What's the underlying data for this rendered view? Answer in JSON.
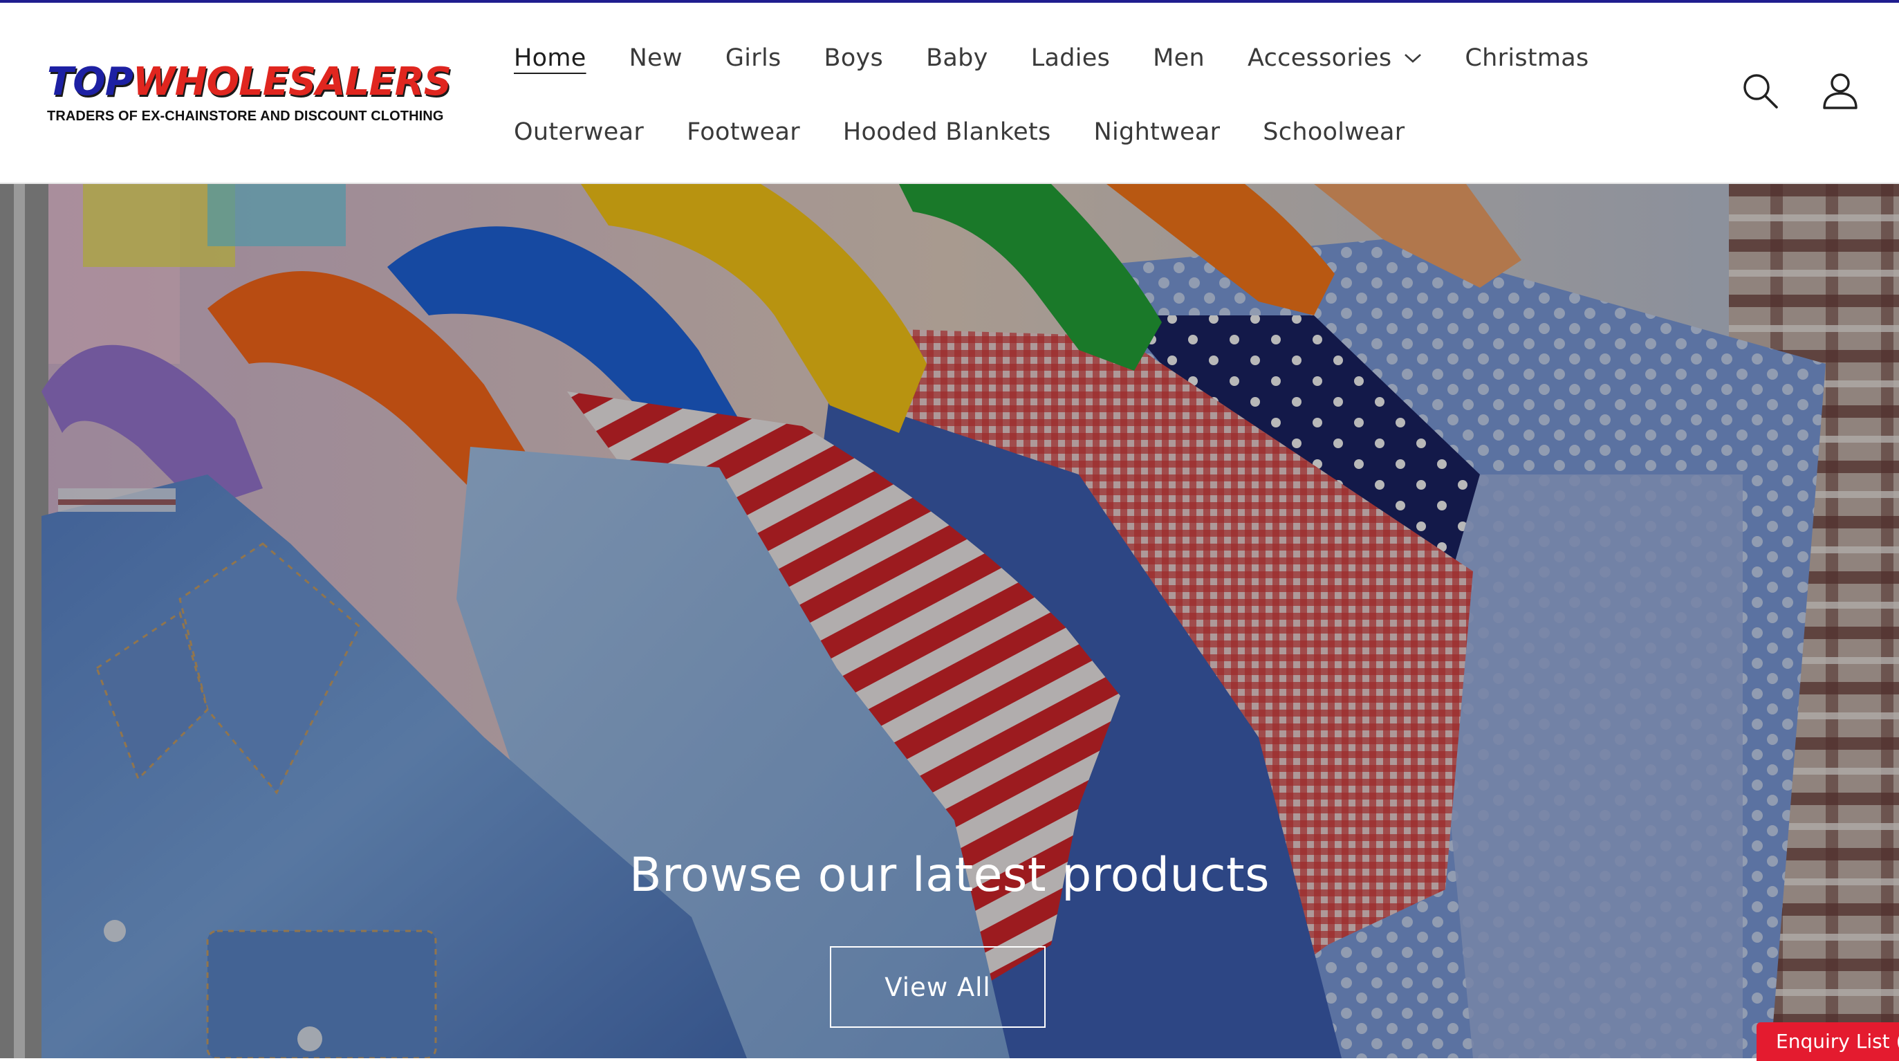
{
  "brand": {
    "name_part1": "TOP",
    "name_part2": "WHOLESALERS",
    "tagline": "TRADERS OF EX-CHAINSTORE AND DISCOUNT CLOTHING",
    "colors": {
      "primary": "#1d20a3",
      "accent": "#e0261f"
    }
  },
  "nav": {
    "row1": [
      {
        "label": "Home",
        "active": true
      },
      {
        "label": "New"
      },
      {
        "label": "Girls"
      },
      {
        "label": "Boys"
      },
      {
        "label": "Baby"
      },
      {
        "label": "Ladies"
      },
      {
        "label": "Men"
      },
      {
        "label": "Accessories",
        "dropdown": true,
        "icon": "chevron-down-icon"
      },
      {
        "label": "Christmas"
      }
    ],
    "row2": [
      {
        "label": "Outerwear"
      },
      {
        "label": "Footwear"
      },
      {
        "label": "Hooded Blankets"
      },
      {
        "label": "Nightwear"
      },
      {
        "label": "Schoolwear"
      }
    ]
  },
  "header_icons": [
    "search-icon",
    "account-icon"
  ],
  "hero": {
    "heading": "Browse our latest products",
    "button_label": "View All",
    "image": "colourful children's clothes on hangers"
  },
  "enquiry": {
    "label": "Enquiry List (",
    "color": "#e41b2f"
  }
}
